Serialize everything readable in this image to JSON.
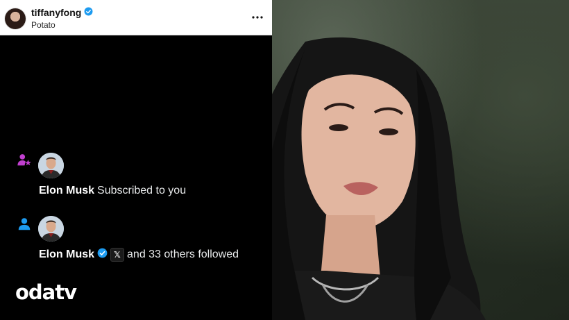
{
  "instagram_header": {
    "username": "tiffanyfong",
    "subtitle": "Potato",
    "avatar_icon": "profile-photo",
    "verified_icon": "verified-badge-icon",
    "more_icon": "more-options-icon"
  },
  "notifications": [
    {
      "icon": "subscribed-person-star-icon",
      "icon_color": "#c13fcf",
      "avatar": "elon-musk-avatar",
      "name": "Elon Musk",
      "action": "Subscribed to you"
    },
    {
      "icon": "follow-person-icon",
      "icon_color": "#1d9bf0",
      "avatar": "elon-musk-avatar",
      "name": "Elon Musk",
      "badge_x": "𝕏",
      "action": "and 33 others followed"
    }
  ],
  "watermark": {
    "logo_text": "odatv"
  },
  "colors": {
    "verified_blue": "#1d9bf0",
    "panel_bg": "#000000"
  }
}
